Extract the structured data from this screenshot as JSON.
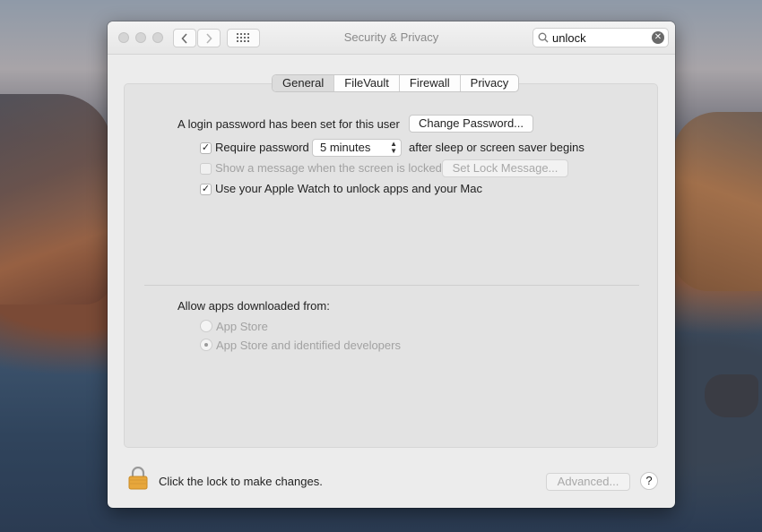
{
  "window": {
    "title": "Security & Privacy",
    "search": {
      "value": "unlock",
      "placeholder": "Search"
    }
  },
  "tabs": [
    {
      "label": "General",
      "selected": true
    },
    {
      "label": "FileVault",
      "selected": false
    },
    {
      "label": "Firewall",
      "selected": false
    },
    {
      "label": "Privacy",
      "selected": false
    }
  ],
  "general": {
    "login_password_text": "A login password has been set for this user",
    "change_password_label": "Change Password...",
    "require_password": {
      "label": "Require password",
      "checked": true,
      "delay": "5 minutes",
      "suffix": "after sleep or screen saver begins"
    },
    "show_message": {
      "label": "Show a message when the screen is locked",
      "checked": false,
      "enabled": false,
      "button_label": "Set Lock Message..."
    },
    "apple_watch": {
      "label": "Use your Apple Watch to unlock apps and your Mac",
      "checked": true
    }
  },
  "downloads": {
    "heading": "Allow apps downloaded from:",
    "options": [
      {
        "label": "App Store",
        "selected": false,
        "enabled": false
      },
      {
        "label": "App Store and identified developers",
        "selected": true,
        "enabled": false
      }
    ]
  },
  "footer": {
    "lock_text": "Click the lock to make changes.",
    "advanced_label": "Advanced...",
    "help_label": "?"
  },
  "colors": {
    "lock": "#e7a73c",
    "window_bg": "#ececec",
    "panel_bg": "#e3e3e3",
    "disabled_text": "#a2a2a2"
  }
}
